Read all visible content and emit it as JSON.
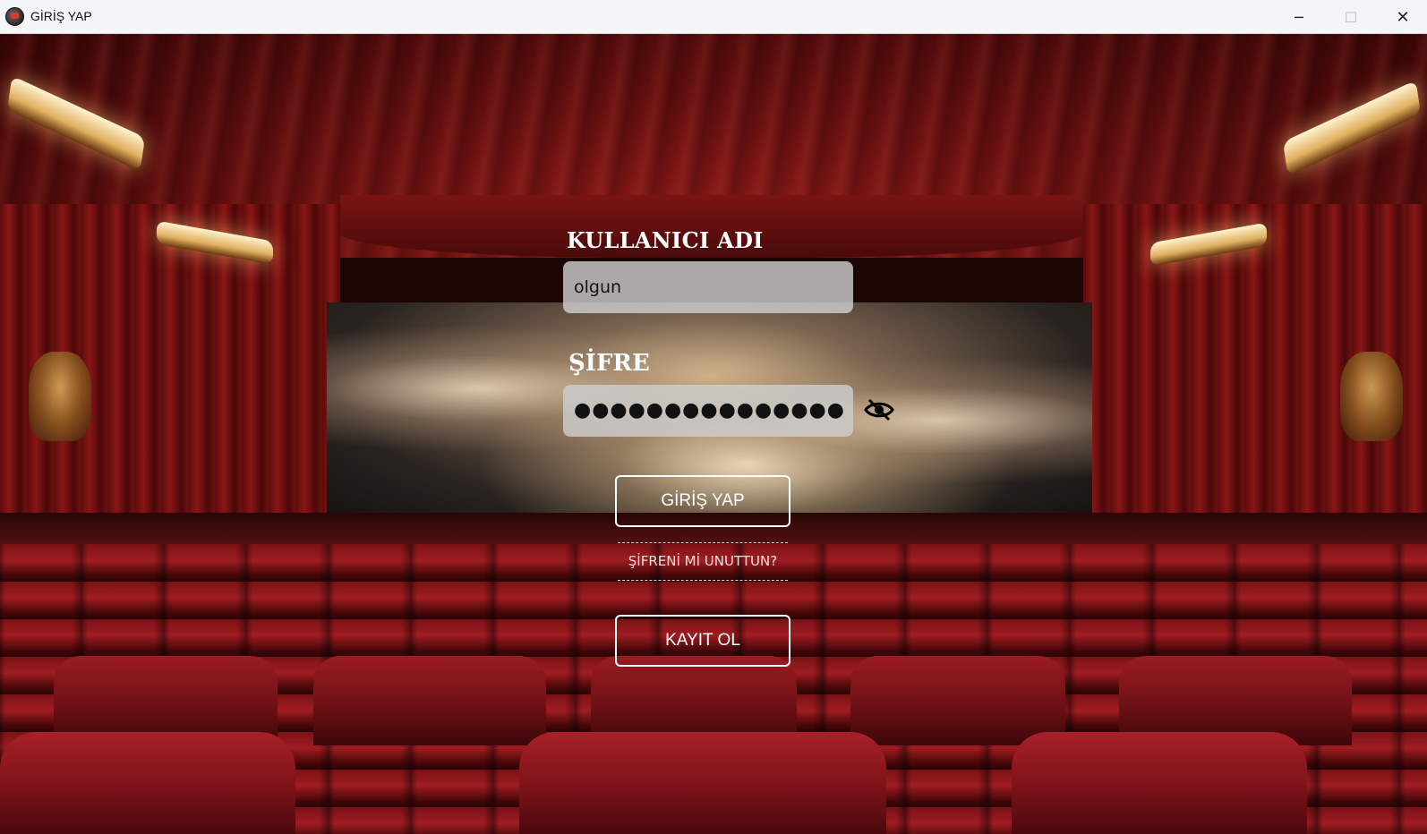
{
  "window": {
    "title": "GİRİŞ YAP",
    "app_icon": "film-reel-icon",
    "controls": {
      "minimize": "─",
      "maximize": "☐",
      "close": "✕"
    }
  },
  "form": {
    "username_label": "KULLANICI ADI",
    "username_value": "olgun",
    "password_label": "ŞİFRE",
    "password_masked": "●●●●●●●●●●●●●●●",
    "password_visibility_icon": "eye-slash-icon",
    "login_button": "GİRİŞ YAP",
    "forgot_link": "ŞİFRENİ Mİ UNUTTUN?",
    "register_button": "KAYIT OL"
  },
  "colors": {
    "text": "#ffffff",
    "input_bg": "#cdcdcd",
    "curtain_red": "#8a1616"
  }
}
